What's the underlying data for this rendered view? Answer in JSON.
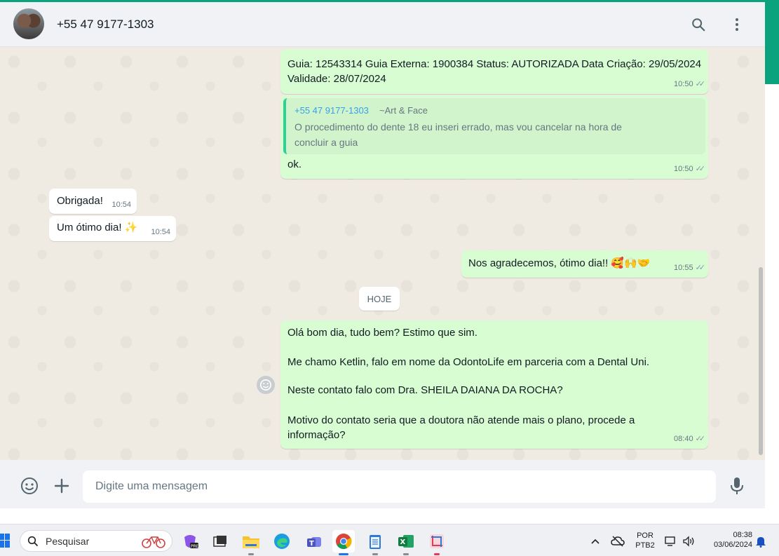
{
  "header": {
    "contact_name": "+55 47 9177-1303"
  },
  "messages": {
    "m1": {
      "line1": "Guia: 12543314 Guia Externa: 1900384 Status: AUTORIZADA Data Criação: 29/05/2024",
      "line2": "Validade: 28/07/2024",
      "time": "10:50"
    },
    "m2": {
      "quote_author": "+55 47 9177-1303",
      "quote_group": "~Art & Face",
      "quote_line1": "O procedimento do dente 18 eu inseri errado, mas vou cancelar na hora de",
      "quote_line2": "concluir a guia",
      "text": "ok.",
      "time": "10:50"
    },
    "m3": {
      "text": "Obrigada!",
      "time": "10:54"
    },
    "m4": {
      "text": "Um ótimo dia! ✨",
      "time": "10:54"
    },
    "m5": {
      "text": "Nos agradecemos, ótimo dia!! 🥰🙌🤝",
      "time": "10:55"
    },
    "date_chip": "HOJE",
    "m6": {
      "p1": "Olá bom dia, tudo bem? Estimo que sim.",
      "p2": "Me chamo Ketlin, falo em nome da OdontoLife em parceria com a Dental Uni.",
      "p3": "Neste contato falo com Dra. SHEILA DAIANA DA ROCHA?",
      "p4a": "Motivo do contato seria que a doutora não atende mais o plano, procede a",
      "p4b": "informação?",
      "time": "08:40"
    }
  },
  "composer": {
    "placeholder": "Digite uma mensagem"
  },
  "taskbar": {
    "search_label": "Pesquisar",
    "lang_line1": "POR",
    "lang_line2": "PTB2",
    "clock_time": "08:38",
    "clock_date": "03/06/2024"
  },
  "colors": {
    "outgoing_bubble": "#d9fdd3",
    "incoming_bubble": "#ffffff",
    "accent": "#00a884"
  }
}
